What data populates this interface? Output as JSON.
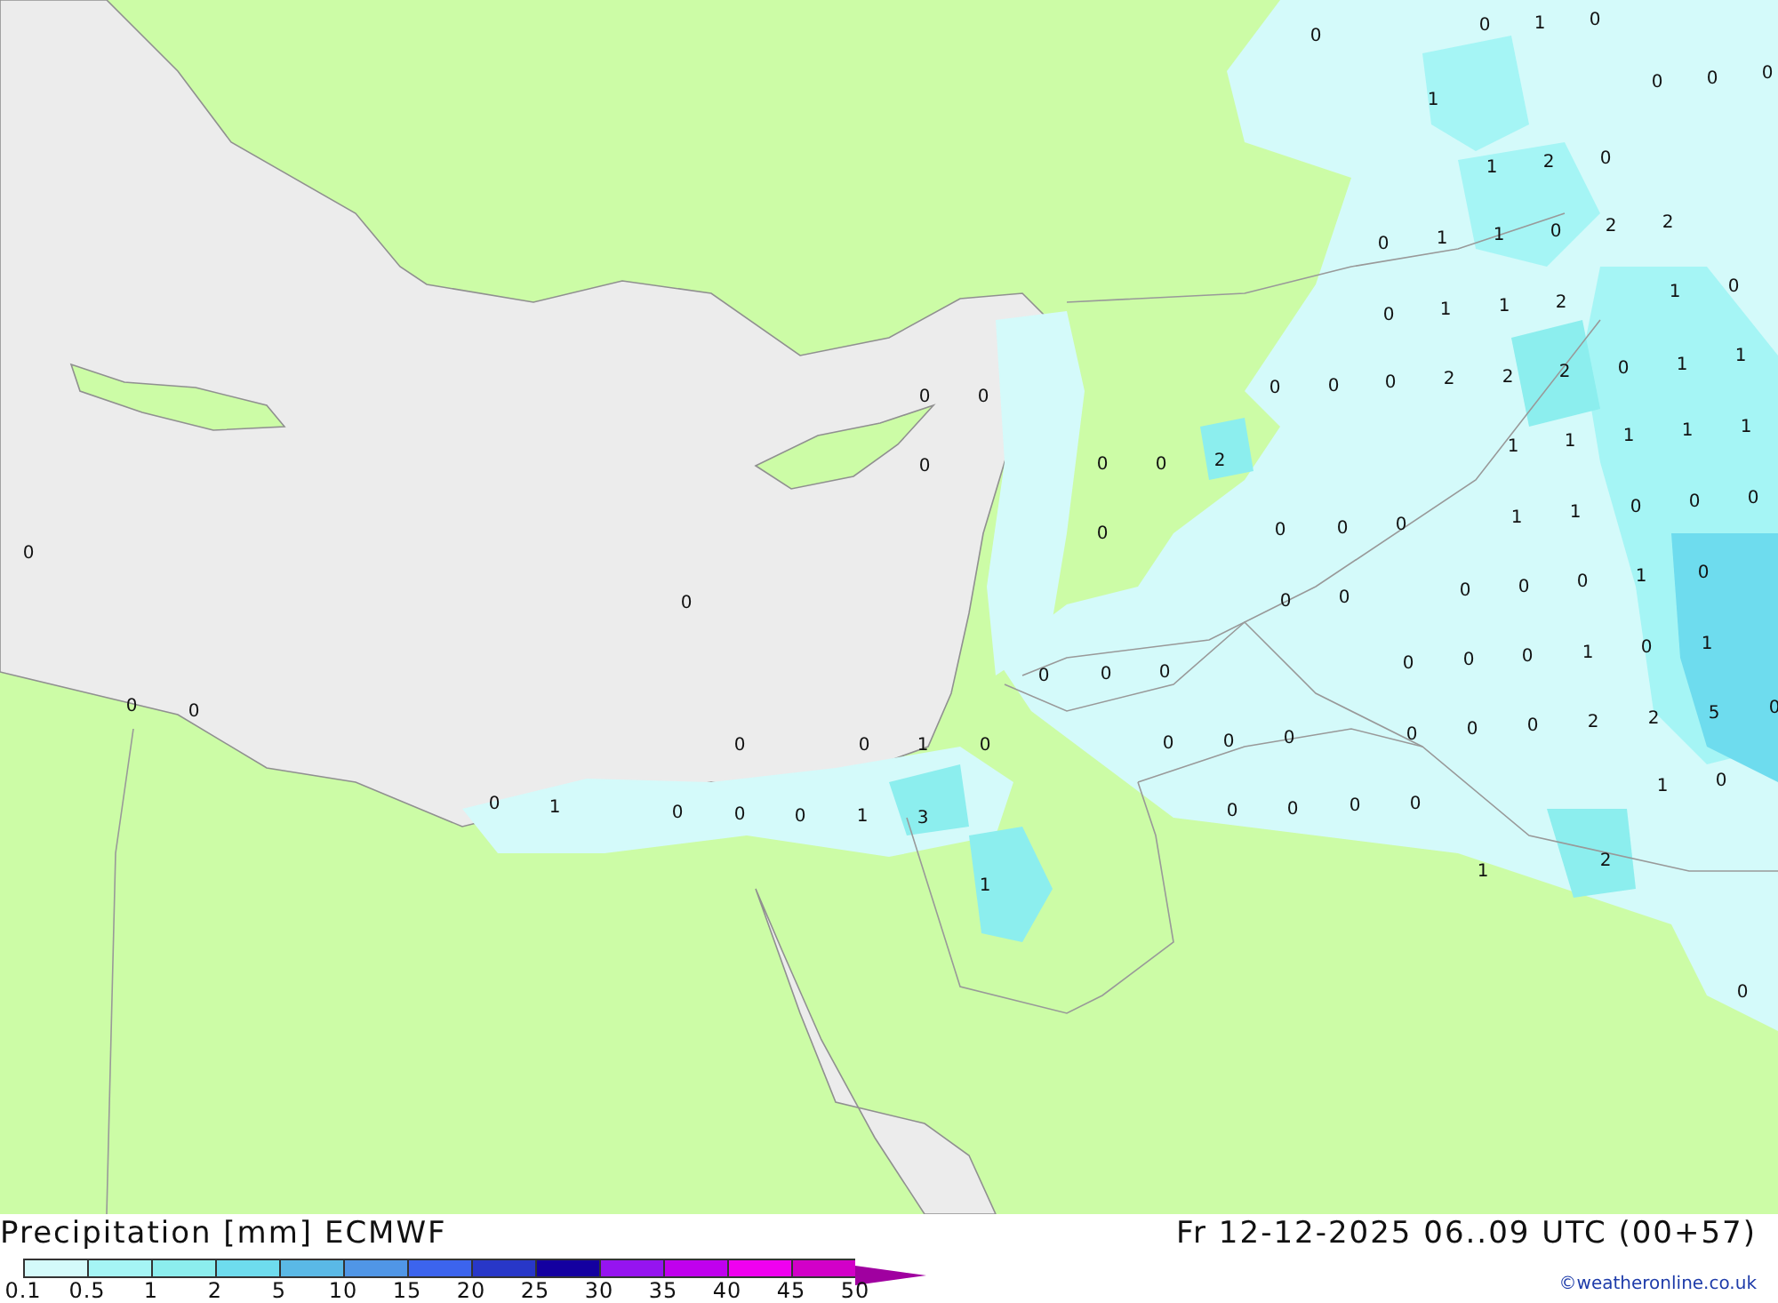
{
  "map": {
    "labels": [
      "0",
      "0",
      "1",
      "0",
      "1",
      "0",
      "0",
      "0",
      "1",
      "2",
      "0",
      "0",
      "1",
      "1",
      "0",
      "2",
      "2",
      "1",
      "0",
      "0",
      "1",
      "1",
      "2",
      "0",
      "0",
      "0",
      "0",
      "0",
      "2",
      "2",
      "2",
      "0",
      "1",
      "1",
      "0",
      "0",
      "0",
      "2",
      "1",
      "1",
      "1",
      "1",
      "1",
      "0",
      "0",
      "0",
      "0",
      "1",
      "1",
      "0",
      "0",
      "0",
      "0",
      "0",
      "0",
      "0",
      "0",
      "0",
      "0",
      "1",
      "0",
      "1",
      "0",
      "0",
      "0",
      "1",
      "0",
      "0",
      "0",
      "0",
      "0",
      "0",
      "0",
      "0",
      "1",
      "0",
      "0",
      "0",
      "0",
      "0",
      "0",
      "0",
      "2",
      "2",
      "5",
      "0",
      "1",
      "0",
      "0",
      "1",
      "0",
      "0",
      "0",
      "1",
      "3",
      "0",
      "0",
      "0",
      "0",
      "1",
      "2",
      "1",
      "0"
    ]
  },
  "legend": {
    "title": "Precipitation [mm]",
    "model": "ECMWF",
    "stops": [
      {
        "label": "0.1",
        "color": "#d4fafa"
      },
      {
        "label": "0.5",
        "color": "#a5f5f5"
      },
      {
        "label": "1",
        "color": "#8ceeee"
      },
      {
        "label": "2",
        "color": "#6edcee"
      },
      {
        "label": "5",
        "color": "#5ab9e6"
      },
      {
        "label": "10",
        "color": "#5096e6"
      },
      {
        "label": "15",
        "color": "#3c64ee"
      },
      {
        "label": "20",
        "color": "#2837c8"
      },
      {
        "label": "25",
        "color": "#1400a0"
      },
      {
        "label": "30",
        "color": "#9614f0"
      },
      {
        "label": "35",
        "color": "#c000ee"
      },
      {
        "label": "40",
        "color": "#f000f0"
      },
      {
        "label": "45",
        "color": "#d200c8"
      },
      {
        "label": "50",
        "color": "#a000a0"
      }
    ]
  },
  "valid_time": "Fr 12-12-2025 06..09 UTC (00+57)",
  "credit": "©weatheronline.co.uk"
}
